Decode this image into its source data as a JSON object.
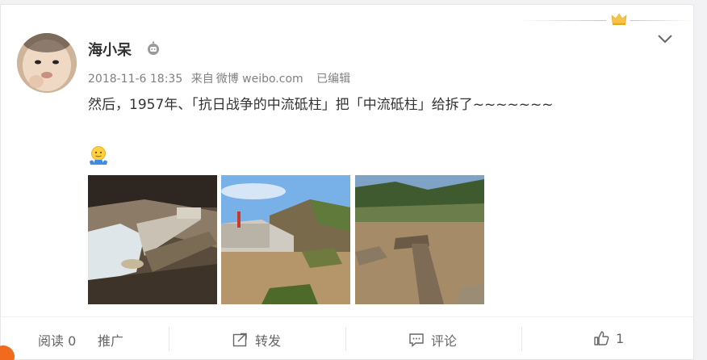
{
  "post": {
    "username": "海小呆",
    "timestamp": "2018-11-6 18:35",
    "source_prefix": "来自",
    "source": "微博 weibo.com",
    "edited": "已编辑",
    "text": "然后，1957年、「抗日战争的中流砥柱」把「中流砥柱」给拆了~~~~~~~"
  },
  "footer": {
    "reads": "阅读 0",
    "promote": "推广",
    "repost": "转发",
    "comment": "评论",
    "likes": "1"
  },
  "colors": {
    "gold": "#f7c247",
    "text": "#333333",
    "meta": "#808080",
    "footer_text": "#666666"
  },
  "icons": [
    "crown-icon",
    "robot-verify-icon",
    "chevron-down-icon",
    "shrug-emoji-icon",
    "share-icon",
    "comment-icon",
    "thumbs-up-icon"
  ]
}
